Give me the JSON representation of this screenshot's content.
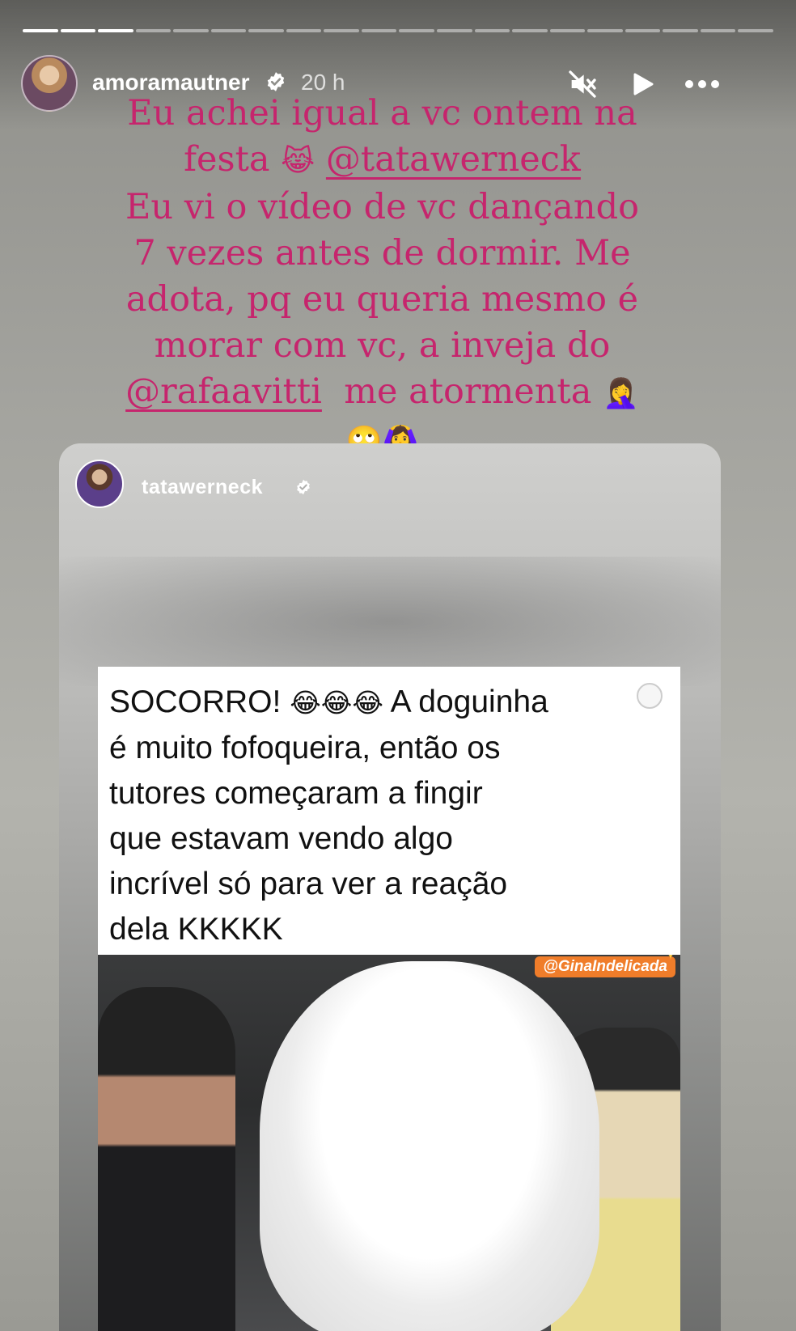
{
  "story": {
    "progress_segments": 20,
    "progress_done": 3,
    "username": "amoramautner",
    "time": "20 h"
  },
  "caption": {
    "lines": [
      "Eu achei igual a vc ontem na",
      "festa",
      "Eu vi o vídeo de vc dançando",
      "7 vezes antes de dormir. Me",
      "adota, pq eu queria mesmo é",
      "morar com vc, a inveja do",
      "me atormenta"
    ],
    "emoji_laugh_cat": "😹",
    "mention_1": "@tatawerneck",
    "mention_2": "@rafaavitti",
    "emoji_facepalm": "🤦‍♀️",
    "emoji_eyeroll": "🙄",
    "emoji_ok_gesture": "🙆‍♀️"
  },
  "post": {
    "username": "tatawerneck",
    "text_line_1": "SOCORRO!",
    "text_emojis": "😂😂😂",
    "text_line_1b": "A doguinha",
    "text_rest": [
      "é muito fofoqueira, então os",
      "tutores começaram a fingir",
      "que estavam vendo algo",
      "incrível só para ver a reação",
      "dela KKKKK"
    ],
    "watermark": "@GinaIndelicada"
  },
  "colors": {
    "caption_pink": "#c6256d",
    "watermark_orange": "#f07d2a"
  }
}
